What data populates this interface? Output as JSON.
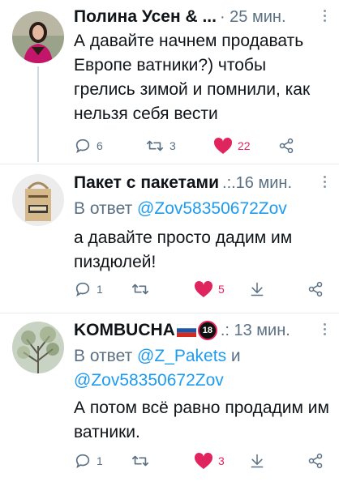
{
  "tweets": [
    {
      "author": "Полина Усен & ...",
      "time": "· 25 мин.",
      "text": "А давайте начнем продавать Европе ватники?) чтобы грелись зимой и помнили, как нельзя себя вести",
      "replies": "6",
      "retweets": "3",
      "likes": "22"
    },
    {
      "author": "Пакет с пакетами",
      "time": ".:.16 мин.",
      "reply_prefix": "В ответ",
      "reply_to": "@Zov58350672Zov",
      "text": "а давайте просто дадим им пиздюлей!",
      "replies": "1",
      "likes": "5"
    },
    {
      "author": "KOMBUCHA",
      "badge": "18",
      "time": ".: 13 мин.",
      "reply_prefix": "В ответ",
      "reply_to_1": "@Z_Pakets",
      "reply_conj": "и",
      "reply_to_2": "@Zov58350672Zov",
      "text": "А потом всё равно продадим им ватники.",
      "replies": "1",
      "likes": "3"
    }
  ],
  "colors": {
    "like": "#e0245e",
    "link": "#1d9bf0",
    "muted": "#5b7083",
    "divider": "#e6ecf0"
  },
  "icons": [
    "reply-icon",
    "retweet-icon",
    "like-icon",
    "share-icon",
    "bookmark-icon",
    "more-icon"
  ]
}
